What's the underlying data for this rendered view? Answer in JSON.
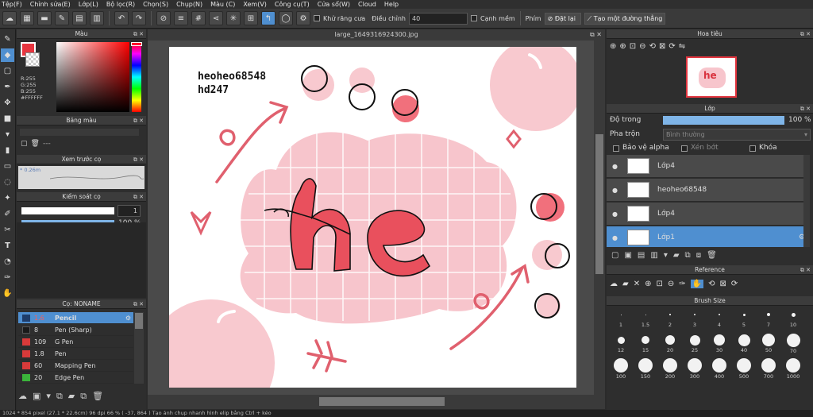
{
  "menu": [
    "Tệp(F)",
    "Chỉnh sửa(E)",
    "Lớp(L)",
    "Bộ lọc(R)",
    "Chọn(S)",
    "Chụp(N)",
    "Màu (C)",
    "Xem(V)",
    "Công cụ(T)",
    "Cửa sổ(W)",
    "Cloud",
    "Help"
  ],
  "toolbar": {
    "antialias_label": "Khử răng cưa",
    "adjust_label": "Điều chỉnh",
    "adjust_value": "40",
    "smooth_label": "Cạnh mềm",
    "key_label": "Phím",
    "reset_label": "Đặt lại",
    "line_label": "Tạo một đường thẳng"
  },
  "color_panel": {
    "title": "Màu",
    "r": "R:255",
    "g": "G:255",
    "b": "B:255",
    "hex": "#FFFFFF",
    "current_color": "#e8353f"
  },
  "palette_panel": {
    "title": "Bảng màu",
    "value": "---"
  },
  "preview_panel": {
    "title": "Xem trước cọ",
    "value": "* 0.26m"
  },
  "brush_control": {
    "title": "Kiểm soát cọ",
    "size": "1",
    "opacity": "100 %"
  },
  "brush_list": {
    "title": "Cọ: NONAME",
    "items": [
      {
        "size": "1.6",
        "name": "Pencil",
        "color": "#1e3d6b",
        "selected": true
      },
      {
        "size": "8",
        "name": "Pen (Sharp)",
        "color": "#1a1a1a"
      },
      {
        "size": "109",
        "name": "G Pen",
        "color": "#d93a3a"
      },
      {
        "size": "1.8",
        "name": "Pen",
        "color": "#d93a3a"
      },
      {
        "size": "60",
        "name": "Mapping Pen",
        "color": "#d93a3a"
      },
      {
        "size": "20",
        "name": "Edge Pen",
        "color": "#3bb53b"
      }
    ]
  },
  "document": {
    "tab": "large_1649316924300.jpg",
    "watermark_line1": "heoheo68548",
    "watermark_line2": "hd247",
    "word": "he"
  },
  "navigator": {
    "title": "Hoa tiêu"
  },
  "layers_panel": {
    "title": "Lớp",
    "opacity_label": "Độ trong",
    "opacity_value": "100 %",
    "opacity_fraction": 1.0,
    "blend_label": "Pha trộn",
    "blend_value": "Bình thường",
    "protect_alpha": "Bảo vệ alpha",
    "clip": "Xén bớt",
    "lock": "Khóa",
    "layers": [
      {
        "name": "Lớp4"
      },
      {
        "name": "heoheo68548"
      },
      {
        "name": "Lớp4"
      },
      {
        "name": "Lớp1",
        "selected": true
      }
    ]
  },
  "reference_panel": {
    "title": "Reference"
  },
  "brush_size_panel": {
    "title": "Brush Size",
    "row1": [
      "1",
      "1.5",
      "2",
      "3",
      "4",
      "5",
      "7",
      "10"
    ],
    "row2": [
      "12",
      "15",
      "20",
      "25",
      "30",
      "40",
      "50",
      "70"
    ],
    "row3": [
      "100",
      "150",
      "200",
      "300",
      "400",
      "500",
      "700",
      "1000"
    ]
  },
  "status": "1024 * 854 pixel  (27.1 * 22.6cm)  96 dpi  66 %  ( -37, 864 )  Tạo ảnh chụp nhanh hình elip bằng Ctrl + kéo"
}
